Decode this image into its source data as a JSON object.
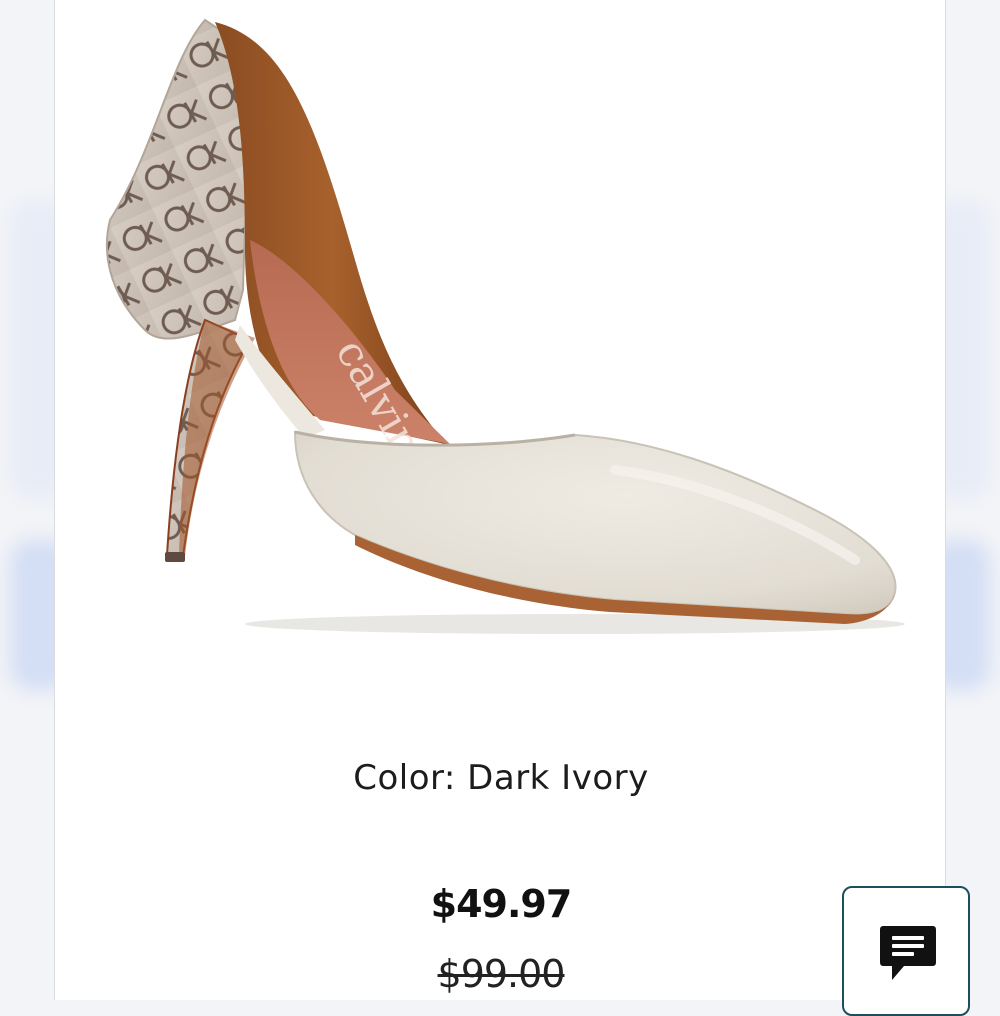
{
  "product": {
    "image_alt": "Calvin Klein pointed-toe d'Orsay pump, dark ivory leather with logo-print heel",
    "brand_script_on_insole": "calvin klein",
    "color_label": "Color: Dark Ivory",
    "sale_price": "$49.97",
    "original_price": "$99.00"
  },
  "chat": {
    "icon": "chat-icon"
  },
  "colors": {
    "card_background": "#ffffff",
    "page_background": "#f3f4f7",
    "price_text": "#111111",
    "chat_border": "#1c4f5e",
    "chat_icon": "#111111"
  }
}
